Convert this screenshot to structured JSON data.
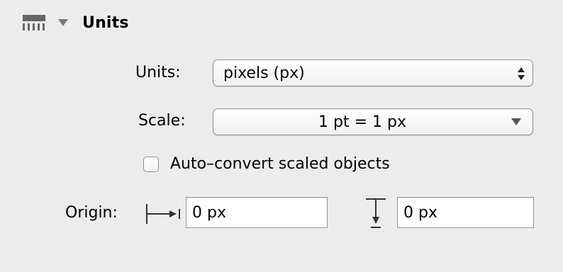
{
  "header": {
    "title": "Units",
    "icon": "ruler-icon",
    "disclosure_icon": "disclosure-triangle-down-icon"
  },
  "units": {
    "label": "Units:",
    "value": "pixels (px)",
    "control_icon": "stepper-up-down-icon"
  },
  "scale": {
    "label": "Scale:",
    "value": "1 pt = 1 px",
    "control_icon": "dropdown-arrow-icon"
  },
  "auto_convert": {
    "label": "Auto–convert scaled objects",
    "checked": false
  },
  "origin": {
    "label": "Origin:",
    "x_icon": "horizontal-origin-icon",
    "x_value": "0 px",
    "y_icon": "vertical-origin-icon",
    "y_value": "0 px"
  }
}
